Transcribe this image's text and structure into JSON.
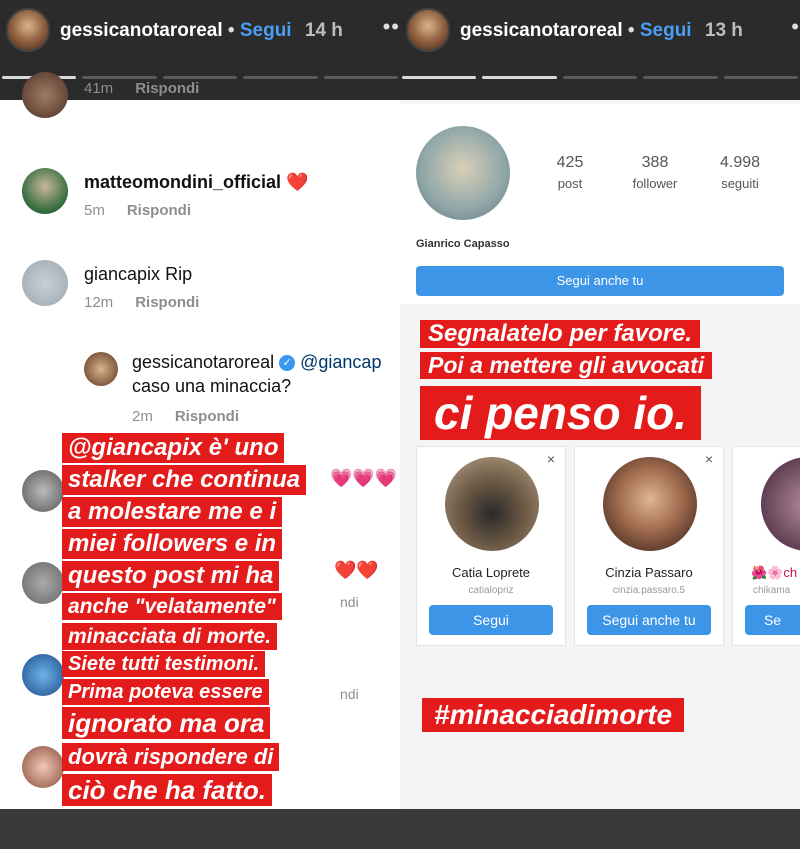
{
  "left_story": {
    "username": "gessicanotaroreal",
    "dot": "•",
    "follow_label": "Segui",
    "time": "14 h",
    "more": "••"
  },
  "right_story": {
    "username": "gessicanotaroreal",
    "dot": "•",
    "follow_label": "Segui",
    "time": "13 h",
    "more": "•"
  },
  "comments": [
    {
      "user": "",
      "text": "",
      "time": "41m",
      "reply": "Rispondi"
    },
    {
      "user": "matteomondini_official",
      "text": "❤️",
      "time": "5m",
      "reply": "Rispondi"
    },
    {
      "user": "giancapix",
      "text": "Rip",
      "time": "12m",
      "reply": "Rispondi"
    },
    {
      "user": "gessicanotaroreal",
      "mention": "@giancap",
      "text": "caso una minaccia?",
      "time": "2m",
      "reply": "Rispondi"
    }
  ],
  "side_fragments": {
    "hearts_pink": "💗💗💗",
    "hearts_red": "❤️❤️",
    "ndi_1": "ndi",
    "ndi_2": "ndi"
  },
  "left_overlay": [
    "@giancapix è' uno",
    "stalker che continua",
    "a molestare me e i",
    "miei followers e in",
    "questo post mi ha",
    "anche \"velatamente\"",
    "minacciata di morte.",
    "Siete tutti testimoni.",
    "Prima poteva essere",
    "ignorato ma ora",
    "dovrà rispondere di",
    "ciò che ha fatto."
  ],
  "profile": {
    "posts": "425",
    "posts_label": "post",
    "followers": "388",
    "followers_label": "follower",
    "following": "4.998",
    "following_label": "seguiti",
    "name": "Gianrico Capasso",
    "follow_back": "Segui anche tu"
  },
  "right_overlay": {
    "line1": "Segnalatelo per favore.",
    "line2": "Poi a mettere gli avvocati",
    "line3": "ci penso io.",
    "hashtag": "#minacciadimorte"
  },
  "suggestions": [
    {
      "name": "Catia Loprete",
      "handle": "catialopriz",
      "button": "Segui",
      "close": "×"
    },
    {
      "name": "Cinzia Passaro",
      "handle": "cinzia.passaro.5",
      "button": "Segui anche tu",
      "close": "×"
    },
    {
      "name": "🌺🌸ch",
      "handle": "chikama",
      "button": "Se",
      "close": ""
    }
  ],
  "colors": {
    "overlay_red": "#e41b1b",
    "follow_blue": "#4a9ff5",
    "button_blue": "#3d95e8"
  }
}
